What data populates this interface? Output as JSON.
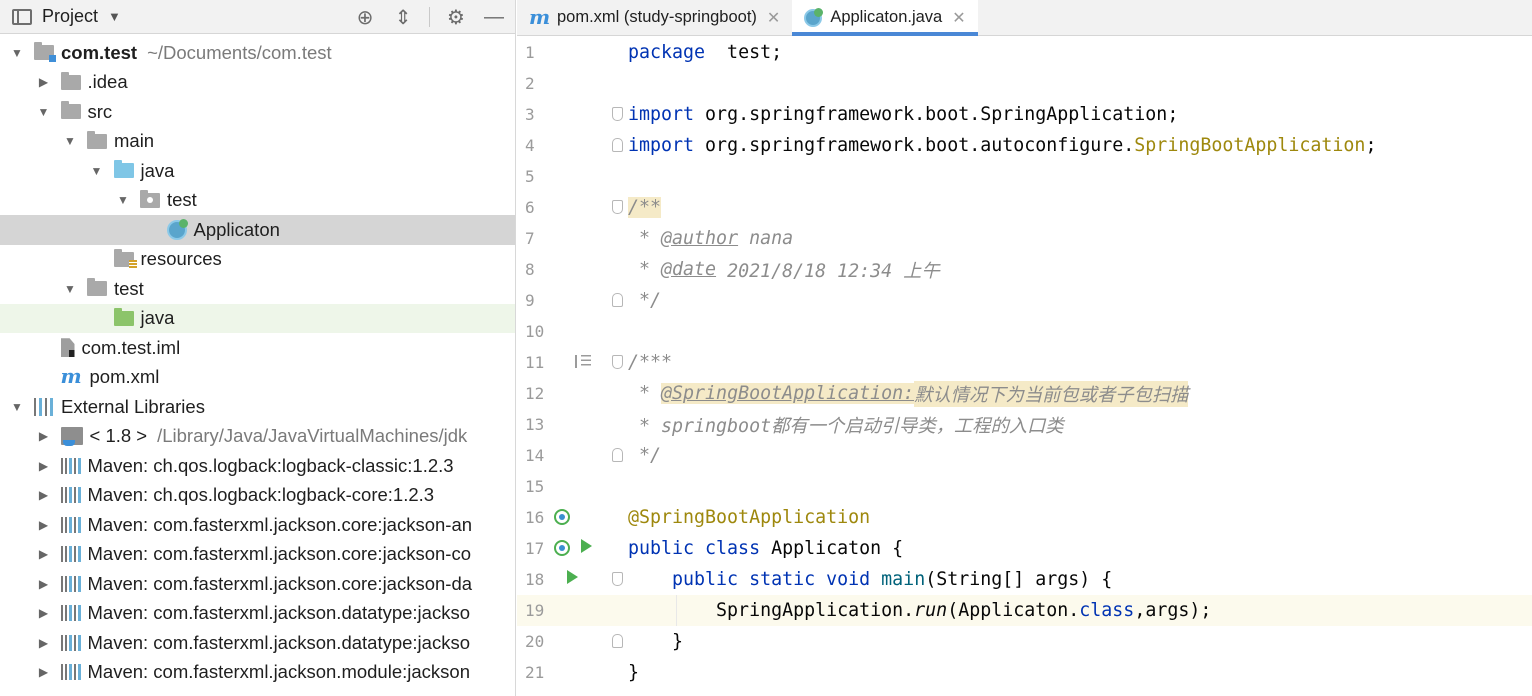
{
  "project_panel": {
    "title": "Project",
    "dropdown_icon": "triangle-down",
    "tool_icons": [
      "locate-icon",
      "collapse-all-icon",
      "gear-icon",
      "minimize-icon"
    ]
  },
  "tree": [
    {
      "label": "com.test",
      "suffix": "~/Documents/com.test",
      "arrow": "▼",
      "icon": "folder module",
      "level": 0,
      "bold": true
    },
    {
      "label": ".idea",
      "arrow": "▶",
      "icon": "folder",
      "level": 1
    },
    {
      "label": "src",
      "arrow": "▼",
      "icon": "folder",
      "level": 1
    },
    {
      "label": "main",
      "arrow": "▼",
      "icon": "folder",
      "level": 2
    },
    {
      "label": "java",
      "arrow": "▼",
      "icon": "folder blue",
      "level": 3
    },
    {
      "label": "test",
      "arrow": "▼",
      "icon": "folder pkg",
      "level": 4
    },
    {
      "label": "Applicaton",
      "arrow": "",
      "icon": "spring-class",
      "level": 5,
      "state": "selected"
    },
    {
      "label": "resources",
      "arrow": "",
      "icon": "folder res",
      "level": 3
    },
    {
      "label": "test",
      "arrow": "▼",
      "icon": "folder",
      "level": 2
    },
    {
      "label": "java",
      "arrow": "",
      "icon": "folder green",
      "level": 3,
      "state": "test-root"
    },
    {
      "label": "com.test.iml",
      "arrow": "",
      "icon": "file-iml",
      "level": 1
    },
    {
      "label": "pom.xml",
      "arrow": "",
      "icon": "maven-m",
      "level": 1
    },
    {
      "label": "External Libraries",
      "arrow": "▼",
      "icon": "libs",
      "level": 0
    },
    {
      "label": "< 1.8 >",
      "suffix": "/Library/Java/JavaVirtualMachines/jdk",
      "arrow": "▶",
      "icon": "jdk",
      "level": 1
    },
    {
      "label": "Maven: ch.qos.logback:logback-classic:1.2.3",
      "arrow": "▶",
      "icon": "mvn-lib",
      "level": 1
    },
    {
      "label": "Maven: ch.qos.logback:logback-core:1.2.3",
      "arrow": "▶",
      "icon": "mvn-lib",
      "level": 1
    },
    {
      "label": "Maven: com.fasterxml.jackson.core:jackson-an",
      "arrow": "▶",
      "icon": "mvn-lib",
      "level": 1
    },
    {
      "label": "Maven: com.fasterxml.jackson.core:jackson-co",
      "arrow": "▶",
      "icon": "mvn-lib",
      "level": 1
    },
    {
      "label": "Maven: com.fasterxml.jackson.core:jackson-da",
      "arrow": "▶",
      "icon": "mvn-lib",
      "level": 1
    },
    {
      "label": "Maven: com.fasterxml.jackson.datatype:jackso",
      "arrow": "▶",
      "icon": "mvn-lib",
      "level": 1
    },
    {
      "label": "Maven: com.fasterxml.jackson.datatype:jackso",
      "arrow": "▶",
      "icon": "mvn-lib",
      "level": 1
    },
    {
      "label": "Maven: com.fasterxml.jackson.module:jackson",
      "arrow": "▶",
      "icon": "mvn-lib",
      "level": 1
    }
  ],
  "tabs": [
    {
      "label": "pom.xml (study-springboot)",
      "icon": "maven-m",
      "active": false
    },
    {
      "label": "Applicaton.java",
      "icon": "spring-class",
      "active": true
    }
  ],
  "editor": {
    "current_line": 19,
    "lines": [
      {
        "n": "1",
        "tokens": [
          [
            "kw",
            "package"
          ],
          [
            "",
            "  test;"
          ]
        ]
      },
      {
        "n": "2",
        "tokens": []
      },
      {
        "n": "3",
        "tokens": [
          [
            "kw",
            "import"
          ],
          [
            "",
            " org.springframework.boot.SpringApplication;"
          ]
        ],
        "fold": "start"
      },
      {
        "n": "4",
        "tokens": [
          [
            "kw",
            "import"
          ],
          [
            "",
            " org.springframework.boot.autoconfigure."
          ],
          [
            "ann",
            "SpringBootApplication"
          ],
          [
            "",
            ";"
          ]
        ],
        "fold": "end"
      },
      {
        "n": "5",
        "tokens": []
      },
      {
        "n": "6",
        "tokens": [
          [
            "cmt hl",
            "/**"
          ]
        ],
        "fold": "start"
      },
      {
        "n": "7",
        "tokens": [
          [
            "cmt",
            " * "
          ],
          [
            "tag",
            "@author"
          ],
          [
            "cmt",
            " nana"
          ]
        ]
      },
      {
        "n": "8",
        "tokens": [
          [
            "cmt",
            " * "
          ],
          [
            "tag",
            "@date"
          ],
          [
            "cmt",
            " 2021/8/18 12:34 上午"
          ]
        ]
      },
      {
        "n": "9",
        "tokens": [
          [
            "cmt",
            " */"
          ]
        ],
        "fold": "end"
      },
      {
        "n": "10",
        "tokens": []
      },
      {
        "n": "11",
        "tokens": [
          [
            "cmt",
            "/***"
          ]
        ],
        "fold": "start",
        "gutter_icon": "doc"
      },
      {
        "n": "12",
        "tokens": [
          [
            "cmt",
            " * "
          ],
          [
            "tag hl",
            "@SpringBootApplication:"
          ],
          [
            "cmt hl",
            "默认情况下为当前包或者子包扫描"
          ]
        ]
      },
      {
        "n": "13",
        "tokens": [
          [
            "cmt",
            " * springboot都有一个启动引导类，工程的入口类"
          ]
        ]
      },
      {
        "n": "14",
        "tokens": [
          [
            "cmt",
            " */"
          ]
        ],
        "fold": "end"
      },
      {
        "n": "15",
        "tokens": []
      },
      {
        "n": "16",
        "tokens": [
          [
            "ann",
            "@SpringBootApplication"
          ]
        ],
        "gutter_icon": "bean"
      },
      {
        "n": "17",
        "tokens": [
          [
            "kw",
            "public class"
          ],
          [
            "",
            " Applicaton {"
          ]
        ],
        "gutter_icon": "bean-run"
      },
      {
        "n": "18",
        "tokens": [
          [
            "",
            "    "
          ],
          [
            "kw",
            "public static void"
          ],
          [
            "",
            " "
          ],
          [
            "method",
            "main"
          ],
          [
            "",
            "(String[] args) {"
          ]
        ],
        "fold": "start",
        "gutter_icon": "run"
      },
      {
        "n": "19",
        "tokens": [
          [
            "",
            "        SpringApplication."
          ],
          [
            "italic",
            "run"
          ],
          [
            "",
            "(Applicaton."
          ],
          [
            "kw",
            "class"
          ],
          [
            "",
            ",args);"
          ]
        ]
      },
      {
        "n": "20",
        "tokens": [
          [
            "",
            "    }"
          ]
        ],
        "fold": "end"
      },
      {
        "n": "21",
        "tokens": [
          [
            "",
            "}"
          ]
        ]
      }
    ]
  }
}
